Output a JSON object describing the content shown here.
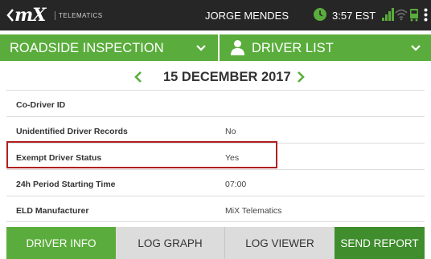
{
  "statusbar": {
    "brand": "mX",
    "brand_sub": "TELEMATICS",
    "user_name": "JORGE MENDES",
    "time": "3:57 EST",
    "icons": [
      "back-chevron-icon",
      "clock-icon",
      "signal-icon",
      "wifi-icon",
      "truck-icon",
      "kebab-menu-icon"
    ]
  },
  "nav": {
    "left_label": "ROADSIDE INSPECTION",
    "right_label": "DRIVER LIST"
  },
  "date": {
    "label": "15 DECEMBER 2017"
  },
  "rows": [
    {
      "label": "Co-Driver ID",
      "value": ""
    },
    {
      "label": "Unidentified Driver Records",
      "value": "No"
    },
    {
      "label": "Exempt Driver Status",
      "value": "Yes"
    },
    {
      "label": "24h Period Starting Time",
      "value": "07:00"
    },
    {
      "label": "ELD Manufacturer",
      "value": "MiX Telematics"
    }
  ],
  "tabs": {
    "driver_info": "DRIVER INFO",
    "log_graph": "LOG GRAPH",
    "log_viewer": "LOG VIEWER",
    "send_report": "SEND REPORT"
  },
  "colors": {
    "statusbar_bg": "#262626",
    "accent_green": "#5aad3c",
    "dark_green": "#3f8d2c",
    "highlight_red": "#b02020",
    "tab_gray": "#dcdcdc"
  }
}
